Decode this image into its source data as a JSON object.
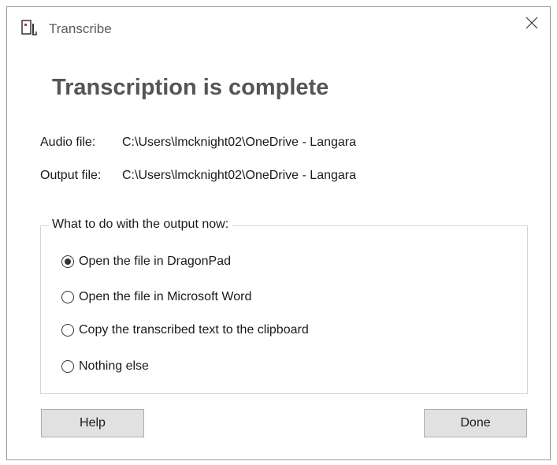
{
  "window": {
    "title": "Transcribe",
    "heading": "Transcription is complete"
  },
  "files": {
    "audio_label": "Audio file:",
    "audio_path": "C:\\Users\\lmcknight02\\OneDrive - Langara",
    "output_label": "Output file:",
    "output_path": "C:\\Users\\lmcknight02\\OneDrive - Langara"
  },
  "options": {
    "legend": "What to do with the output now:",
    "items": [
      {
        "label": "Open the file in DragonPad",
        "checked": true
      },
      {
        "label": "Open the file in Microsoft Word",
        "checked": false
      },
      {
        "label": "Copy the transcribed text to the clipboard",
        "checked": false
      },
      {
        "label": "Nothing else",
        "checked": false
      }
    ]
  },
  "buttons": {
    "help_label": "Help",
    "done_label": "Done"
  },
  "icons": {
    "app": "transcribe-app-icon",
    "close": "close-icon"
  },
  "colors": {
    "heading": "#555555",
    "button_face": "#e1e1e1",
    "icon_red": "#d32f2f"
  }
}
